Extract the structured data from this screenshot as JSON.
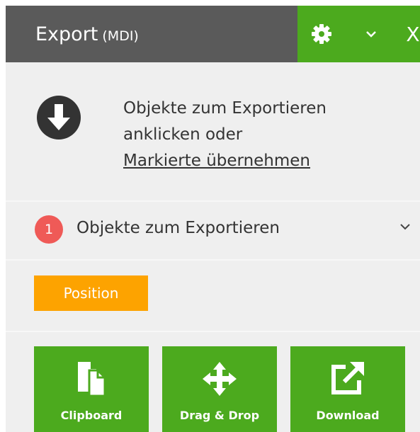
{
  "header": {
    "title": "Export",
    "subtitle": "(MDI)",
    "icons": {
      "settings": "gear-icon",
      "collapse": "chevron-down-icon"
    },
    "close_label": "X"
  },
  "intro": {
    "icon": "download-arrow-icon",
    "line1": "Objekte zum Exportieren",
    "line2": "anklicken oder",
    "link": "Markierte übernehmen"
  },
  "section": {
    "badge": "1",
    "label": "Objekte zum Exportieren"
  },
  "tag": {
    "label": "Position"
  },
  "actions": [
    {
      "label": "Clipboard",
      "icon": "clipboard-icon"
    },
    {
      "label": "Drag & Drop",
      "icon": "move-arrows-icon"
    },
    {
      "label": "Download",
      "icon": "external-link-icon"
    }
  ],
  "colors": {
    "header_dark": "#5a5a5a",
    "accent_green": "#4caa1e",
    "badge_red": "#ef5a57",
    "tag_orange": "#fda300",
    "panel_bg": "#efefef"
  }
}
